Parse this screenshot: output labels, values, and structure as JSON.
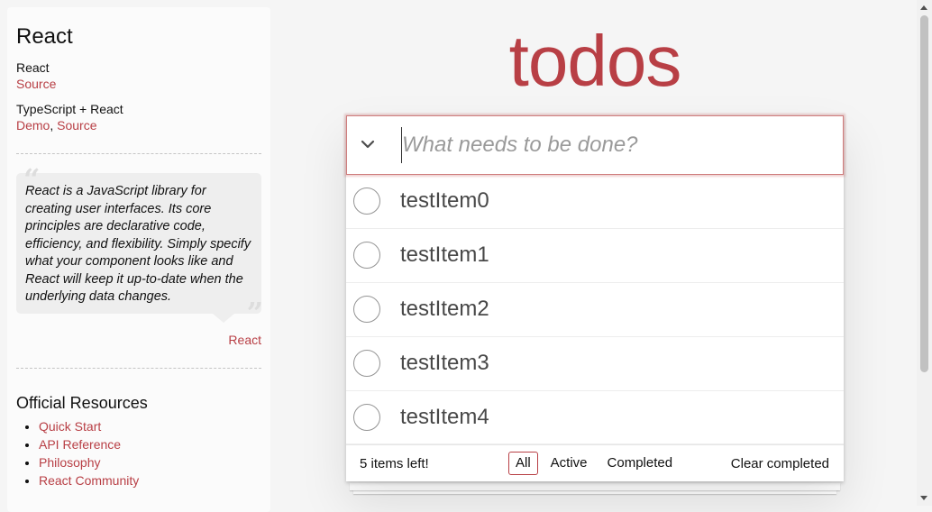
{
  "sidebar": {
    "title": "React",
    "examples": [
      {
        "name": "React",
        "links": [
          "Source"
        ]
      },
      {
        "name": "TypeScript + React",
        "links": [
          "Demo",
          "Source"
        ],
        "separator": ","
      }
    ],
    "quote": {
      "text": "React is a JavaScript library for creating user interfaces. Its core principles are declarative code, efficiency, and flexibility. Simply specify what your component looks like and React will keep it up-to-date when the underlying data changes.",
      "open_mark": "“",
      "close_mark": "”",
      "footer_link": "React"
    },
    "resources": {
      "title": "Official Resources",
      "items": [
        "Quick Start",
        "API Reference",
        "Philosophy",
        "React Community"
      ]
    }
  },
  "app": {
    "title": "todos",
    "new_todo_placeholder": "What needs to be done?",
    "toggle_all_icon": "chevron-down-icon",
    "todos": [
      {
        "label": "testItem0",
        "completed": false
      },
      {
        "label": "testItem1",
        "completed": false
      },
      {
        "label": "testItem2",
        "completed": false
      },
      {
        "label": "testItem3",
        "completed": false
      },
      {
        "label": "testItem4",
        "completed": false
      }
    ],
    "footer": {
      "count_text": "5 items left!",
      "filters": [
        "All",
        "Active",
        "Completed"
      ],
      "selected_filter": "All",
      "clear_label": "Clear completed"
    }
  },
  "colors": {
    "accent": "#b83f45",
    "background": "#f5f5f5"
  }
}
